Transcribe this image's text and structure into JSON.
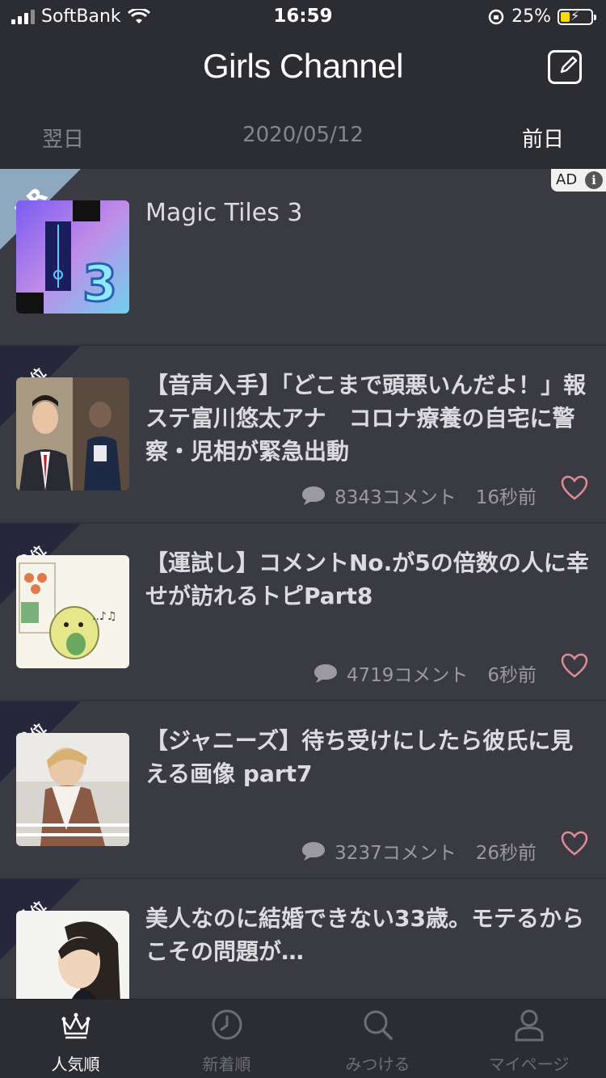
{
  "status_bar": {
    "carrier": "SoftBank",
    "time": "16:59",
    "battery": "25%"
  },
  "header": {
    "title": "Girls Channel",
    "compose_icon": "compose-icon"
  },
  "date_nav": {
    "next_label": "翌日",
    "date": "2020/05/12",
    "prev_label": "前日"
  },
  "items": [
    {
      "ribbon": "PR",
      "ad_label": "AD",
      "title": "Magic Tiles 3",
      "thumb": "magic-tiles-app-icon"
    },
    {
      "ribbon_num": "1",
      "ribbon_suffix": "位",
      "title": "【音声入手】「どこまで頭悪いんだよ！」報ステ富川悠太アナ　コロナ療養の自宅に警察・児相が緊急出動",
      "comments": "8343コメント",
      "time": "16秒前"
    },
    {
      "ribbon_num": "2",
      "ribbon_suffix": "位",
      "title": "【運試し】コメントNo.が5の倍数の人に幸せが訪れるトピPart8",
      "comments": "4719コメント",
      "time": "6秒前"
    },
    {
      "ribbon_num": "3",
      "ribbon_suffix": "位",
      "title": "【ジャニーズ】待ち受けにしたら彼氏に見える画像 part7",
      "comments": "3237コメント",
      "time": "26秒前"
    },
    {
      "ribbon_num": "4",
      "ribbon_suffix": "位",
      "title": "美人なのに結婚できない33歳。モテるからこその問題が…"
    }
  ],
  "tabs": [
    {
      "label": "人気順",
      "icon": "crown-icon",
      "active": true
    },
    {
      "label": "新着順",
      "icon": "clock-icon",
      "active": false
    },
    {
      "label": "みつける",
      "icon": "search-icon",
      "active": false
    },
    {
      "label": "マイページ",
      "icon": "person-icon",
      "active": false
    }
  ],
  "colors": {
    "background": "#3a3a42",
    "bar": "#2c2c33",
    "ribbon_rank": "#26273a",
    "ribbon_pr": "#8ea8c0",
    "heart": "#e08a9a"
  }
}
